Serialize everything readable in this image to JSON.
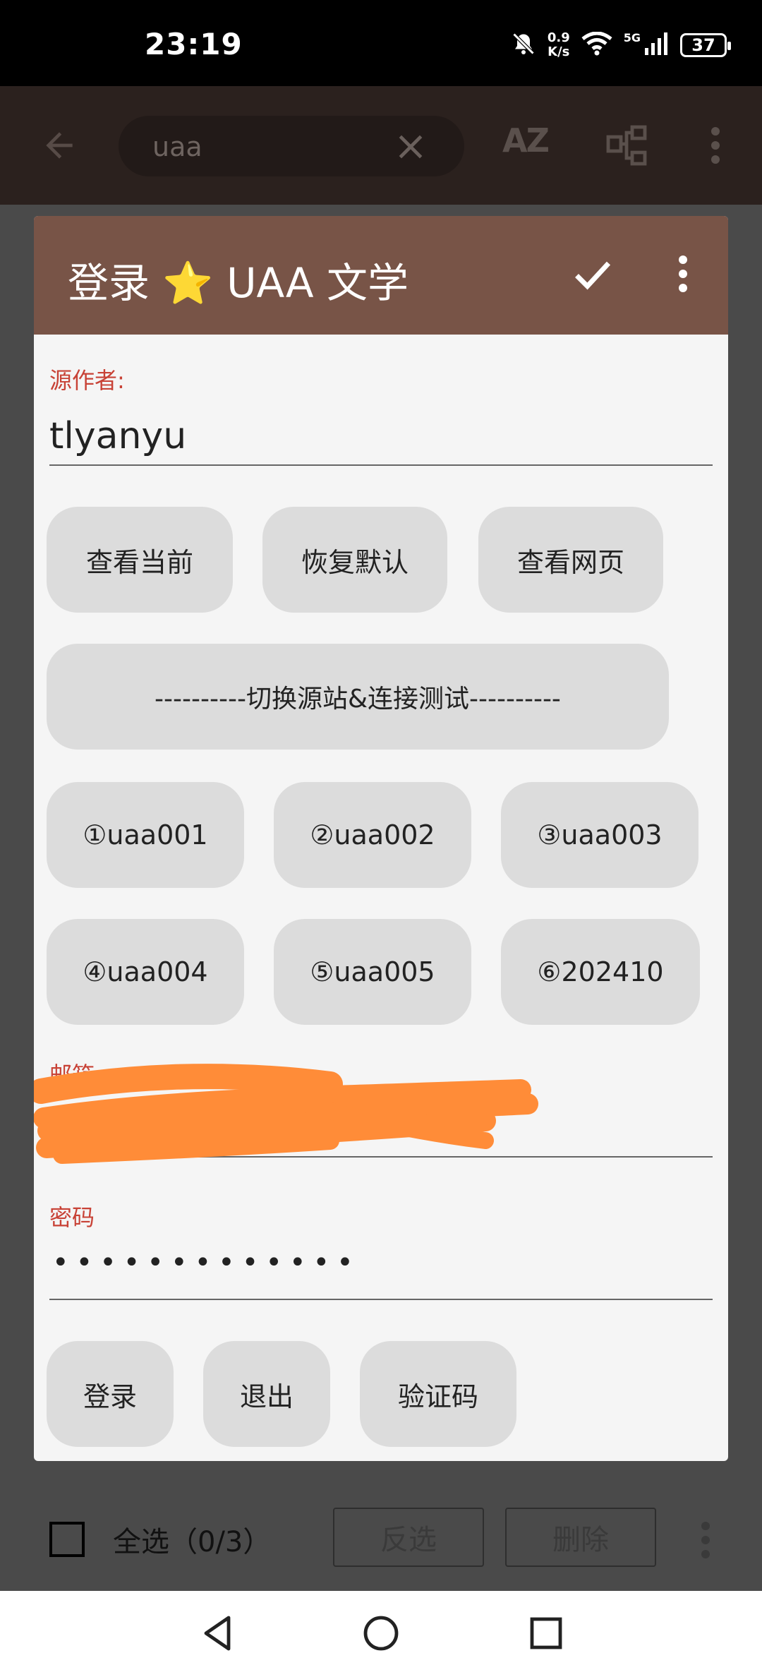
{
  "status_bar": {
    "time": "23:19",
    "net_speed_value": "0.9",
    "net_speed_unit": "K/s",
    "signal_label": "5G",
    "battery": "37"
  },
  "toolbar": {
    "search_value": "uaa",
    "sort_label": "AZ"
  },
  "dialog": {
    "title": "登录 ⭐ UAA 文学",
    "author_label": "源作者:",
    "author_value": "tlyanyu",
    "buttons_row1": [
      "查看当前",
      "恢复默认",
      "查看网页"
    ],
    "switch_button": "----------切换源站&连接测试----------",
    "sites_row1": [
      "①uaa001",
      "②uaa002",
      "③uaa003"
    ],
    "sites_row2": [
      "④uaa004",
      "⑤uaa005",
      "⑥202410"
    ],
    "email_label": "邮箱",
    "password_label": "密码",
    "password_value": "•••••••••••••",
    "action_buttons": [
      "登录",
      "退出",
      "验证码"
    ]
  },
  "action_bar": {
    "select_all": "全选（0/3）",
    "invert": "反选",
    "delete": "删除"
  },
  "colors": {
    "header": "#785447",
    "label": "#c84236",
    "redaction": "#ff8c38"
  }
}
